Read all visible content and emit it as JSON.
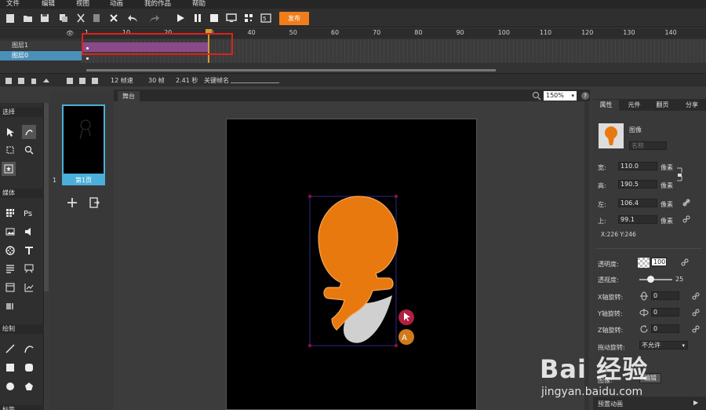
{
  "menu": [
    "文件",
    "编辑",
    "视图",
    "动画",
    "我的作品",
    "帮助"
  ],
  "toolbar": {
    "publish_label": "发布"
  },
  "timeline": {
    "ruler_ticks": [
      "1",
      "10",
      "20",
      "30",
      "40",
      "50",
      "60",
      "70",
      "80",
      "90",
      "100",
      "110",
      "120",
      "130",
      "140"
    ],
    "layers": [
      "图层1",
      "图层0"
    ]
  },
  "timeline_status": {
    "fps": "12 帧速",
    "frames": "30 帧",
    "seconds": "2.41 秒",
    "keyframe_name_label": "关键帧名"
  },
  "tools": {
    "section_select": "选择",
    "section_media": "媒体",
    "section_draw": "绘制",
    "section_bottom": "标签"
  },
  "pages": {
    "page_number": "1",
    "page_label": "第1页"
  },
  "stage": {
    "tab_label": "舞台",
    "zoom": "150%"
  },
  "properties": {
    "tabs": [
      "属性",
      "元件",
      "翻页",
      "分享"
    ],
    "object_type": "图像",
    "name_placeholder": "名称",
    "width_label": "宽:",
    "width_value": "110.0",
    "height_label": "高:",
    "height_value": "190.5",
    "left_label": "左:",
    "left_value": "106.4",
    "top_label": "上:",
    "top_value": "99.1",
    "unit": "像素",
    "coords": "X:226   Y:246",
    "opacity_label": "透明度:",
    "opacity_value": "100",
    "perspective_label": "透视度:",
    "perspective_value": "25",
    "x_rotate_label": "X轴旋转:",
    "x_rotate_value": "0",
    "y_rotate_label": "Y轴旋转:",
    "y_rotate_value": "0",
    "z_rotate_label": "Z轴旋转:",
    "z_rotate_value": "0",
    "drag_rotate_label": "拖动旋转:",
    "drag_rotate_value": "不允许",
    "image_label": "图像:",
    "edit_button": "编辑",
    "bottom_section": "预置动画"
  },
  "watermark": {
    "brand": "Bai 经验",
    "url": "jingyan.baidu.com"
  },
  "colors": {
    "accent": "#f07d1a",
    "selection": "#4ab0d9",
    "tween": "#8a4a8a",
    "highlight": "#e0201c",
    "figure": "#e8790e"
  }
}
